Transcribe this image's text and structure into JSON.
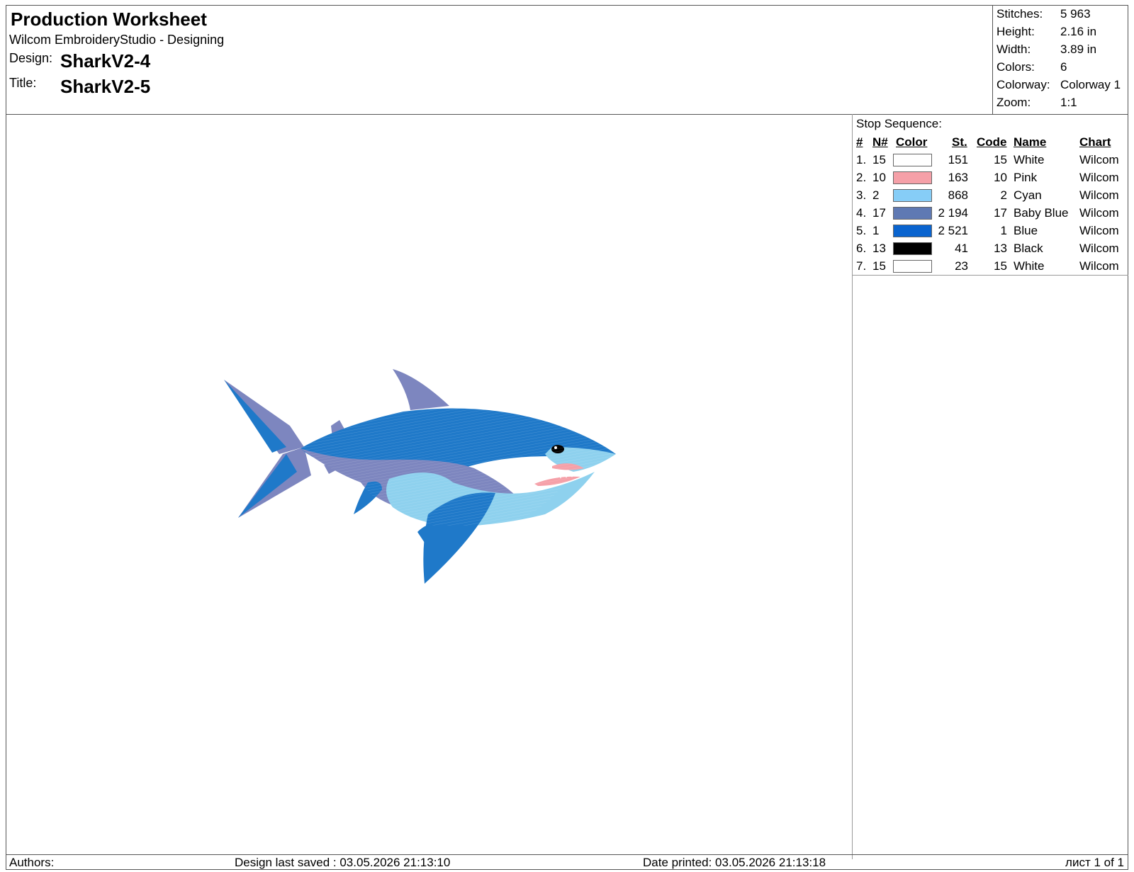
{
  "header": {
    "title": "Production Worksheet",
    "app": "Wilcom EmbroideryStudio - Designing",
    "design_label": "Design:",
    "design_value": "SharkV2-4",
    "title_label": "Title:",
    "title_value": "SharkV2-5"
  },
  "stats": [
    {
      "label": "Stitches:",
      "value": "5 963"
    },
    {
      "label": "Height:",
      "value": "2.16 in"
    },
    {
      "label": "Width:",
      "value": "3.89 in"
    },
    {
      "label": "Colors:",
      "value": "6"
    },
    {
      "label": "Colorway:",
      "value": "Colorway 1"
    },
    {
      "label": "Zoom:",
      "value": "1:1"
    }
  ],
  "stop_sequence": {
    "title": "Stop Sequence:",
    "headers": {
      "num": "#",
      "n": "N#",
      "color": "Color",
      "st": "St.",
      "code": "Code",
      "name": "Name",
      "chart": "Chart"
    },
    "rows": [
      {
        "num": "1.",
        "n": "15",
        "swatch": "#ffffff",
        "st": "151",
        "code": "15",
        "name": "White",
        "chart": "Wilcom"
      },
      {
        "num": "2.",
        "n": "10",
        "swatch": "#f5a0a8",
        "st": "163",
        "code": "10",
        "name": "Pink",
        "chart": "Wilcom"
      },
      {
        "num": "3.",
        "n": "2",
        "swatch": "#86cdf7",
        "st": "868",
        "code": "2",
        "name": "Cyan",
        "chart": "Wilcom"
      },
      {
        "num": "4.",
        "n": "17",
        "swatch": "#5f79b3",
        "st": "2 194",
        "code": "17",
        "name": "Baby Blue",
        "chart": "Wilcom"
      },
      {
        "num": "5.",
        "n": "1",
        "swatch": "#0a64cf",
        "st": "2 521",
        "code": "1",
        "name": "Blue",
        "chart": "Wilcom"
      },
      {
        "num": "6.",
        "n": "13",
        "swatch": "#000000",
        "st": "41",
        "code": "13",
        "name": "Black",
        "chart": "Wilcom"
      },
      {
        "num": "7.",
        "n": "15",
        "swatch": "#ffffff",
        "st": "23",
        "code": "15",
        "name": "White",
        "chart": "Wilcom"
      }
    ]
  },
  "footer": {
    "authors": "Authors:",
    "saved": "Design last saved : 03.05.2026 21:13:10",
    "printed": "Date printed: 03.05.2026 21:13:18",
    "page": "лист 1 of 1"
  },
  "design_colors": {
    "blue": "#1f79c9",
    "baby_blue": "#7d86bf",
    "cyan": "#8ed1ee",
    "pink": "#f5a0a8",
    "black": "#000000",
    "white": "#ffffff"
  }
}
